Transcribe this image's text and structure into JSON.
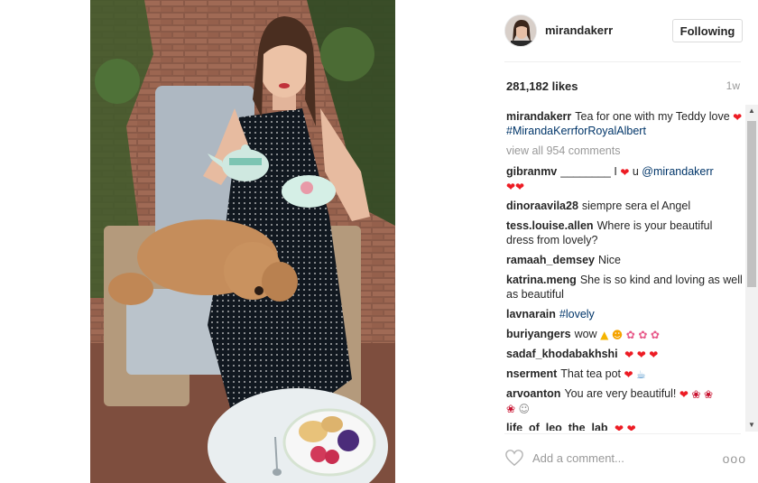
{
  "post": {
    "username": "mirandakerr",
    "follow_label": "Following",
    "likes": "281,182 likes",
    "time_ago": "1w",
    "caption": {
      "user": "mirandakerr",
      "text": "Tea for one with my Teddy love",
      "hashtag": "#MirandaKerrforRoyalAlbert"
    },
    "view_all": "view all 954 comments",
    "comments": [
      {
        "user": "gibranmv",
        "text": "________ I",
        "tail": "u",
        "mention": "@mirandakerr"
      },
      {
        "user": "dinoraavila28",
        "text": "siempre sera el Angel"
      },
      {
        "user": "tess.louise.allen",
        "text": "Where is your beautiful dress from lovely?"
      },
      {
        "user": "ramaah_demsey",
        "text": "Nice"
      },
      {
        "user": "katrina.meng",
        "text": "She is so kind and loving as well as beautiful"
      },
      {
        "user": "lavnarain",
        "hashtag": "#lovely"
      },
      {
        "user": "buriyangers",
        "text": "wow"
      },
      {
        "user": "sadaf_khodabakhshi",
        "text": ""
      },
      {
        "user": "nserment",
        "text": "That tea pot"
      },
      {
        "user": "arvoanton",
        "text": "You are very beautiful!"
      },
      {
        "user": "life_of_leo_the_lab",
        "text": ""
      }
    ],
    "add_comment_placeholder": "Add a comment...",
    "more_label": "ooo"
  },
  "icons": {
    "heart": "heart-icon",
    "heart_outline": "heart-outline-icon",
    "more": "more-options-icon"
  },
  "colors": {
    "link": "#003569",
    "heart": "#ed1c24",
    "muted": "#999999"
  }
}
